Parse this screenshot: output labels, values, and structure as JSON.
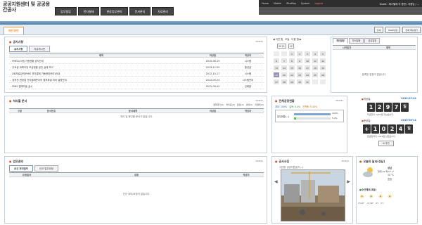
{
  "header": {
    "logo": "공공지원센터 및 공공용간공사",
    "nav": [
      "업무협업",
      "전자결재",
      "현장업무관리",
      "문서관리",
      "자료관리"
    ],
    "util_links": [
      "Home",
      "Mobile",
      "SiteMap",
      "System"
    ],
    "logout": "Logout",
    "user_info": "Guest : 파스텔체 이 종현 / 차중남 / ..."
  },
  "tabs": {
    "home": "메인화면"
  },
  "top_buttons": [
    "인쇄",
    "PAGE상단",
    "전체 메뉴열기"
  ],
  "notice": {
    "title": "공지사항",
    "more": "MORE+",
    "tabs": [
      "공지사항",
      "자유게시판"
    ],
    "columns": [
      "제목",
      "작성일",
      "작성자"
    ],
    "rows": [
      {
        "title": "- PMIS시스템 가동현황 공지안내",
        "date": "2015-06-19",
        "author": "시스템"
      },
      {
        "title": "- 주요공 비축이유 모금현황 공인 실태 보고",
        "date": "2013-12-05",
        "author": "홍성길"
      },
      {
        "title": "- DB자료입력(PMIS 전자결재 가동현장관리)안내",
        "date": "2012-10-17",
        "author": "시스템"
      },
      {
        "title": "- 장부관-현장업 전자결재문서의 첨부파일 처리 설정안내",
        "date": "2012-09-24",
        "author": "시스템관리"
      },
      {
        "title": "- PMIS 결재자동 실시",
        "date": "2012-09-05",
        "author": "신태중"
      }
    ]
  },
  "approval": {
    "title": "처리할 문서",
    "more": "MORE+",
    "filters": [
      "결재대기(0)",
      "처리중(0)",
      "완료(0)",
      "반려(0)",
      "미결제(0)"
    ],
    "columns": [
      "구분",
      "문서번호",
      "문서제목",
      "작성일",
      "작성자"
    ],
    "empty": "처리 및 확인할 문서가 없습니다."
  },
  "calendar": {
    "nav_prev": "◀ 이전 월",
    "nav_today": "오늘",
    "nav_next": "다음 월 ▶",
    "year": "2015",
    "month": "12",
    "days": [
      "",
      "",
      "1",
      "2",
      "3",
      "4",
      "5",
      "6",
      "7",
      "8",
      "9",
      "10",
      "11",
      "12",
      "13",
      "14",
      "15",
      "16",
      "17",
      "18",
      "19",
      "20",
      "21",
      "22",
      "23",
      "24",
      "25",
      "26",
      "27",
      "28",
      "29",
      "30",
      "31",
      "",
      ""
    ],
    "today": "20"
  },
  "schedule": {
    "tabs": [
      "개인일정",
      "부서일정",
      "공유일정"
    ],
    "columns": [
      "시작일자",
      "제목"
    ],
    "empty": "등록된 일정이 없습니다."
  },
  "progress": {
    "title": "전체공정현황",
    "more": "MORE+",
    "plan_label": "계획: 100%",
    "actual_label": "실적: 5.4%",
    "diff_label": "진척률: 5.40%",
    "row_label": "업무현황(...)",
    "pct_top": "100%",
    "pct_bottom": "5.4%",
    "plan_value": 100,
    "actual_value": 5.4
  },
  "counters": {
    "start_label": "착공일:",
    "start_date": "2012-07-01",
    "elapsed_digits": [
      "1",
      "2",
      "9",
      "7",
      "일"
    ],
    "elapsed_note": "착공한지 1297일 지났습니다.",
    "finish_label": "준공일:",
    "finish_date": "2019-09-11",
    "remain_digits": [
      "+",
      "1",
      "0",
      "2",
      "4",
      "일"
    ],
    "remain_note": "준공일까지 1024일 남았습니다.",
    "button": "추가"
  },
  "work": {
    "title": "업무관리",
    "more": "MORE+",
    "tabs": [
      "신규 처리업무",
      "신규 업무요청"
    ],
    "columns": [
      "요청일자",
      "내용",
      "작성자"
    ],
    "empty": "신규 처리/요청이 없습니다."
  },
  "site_photo": {
    "title": "공사사진",
    "more": "MORE+",
    "caption": "사진명: 공공지원센(지...)"
  },
  "weather": {
    "title": "오늘의 날씨(성남)",
    "location": "성남",
    "temps": "현재 15  최/17  1°",
    "detail": "10  °C",
    "desc": "흐림",
    "sub_title": "수간예보(3일)",
    "forecast": [
      "4°/14°",
      "-1°/10°",
      "2°/",
      "2°/"
    ]
  }
}
